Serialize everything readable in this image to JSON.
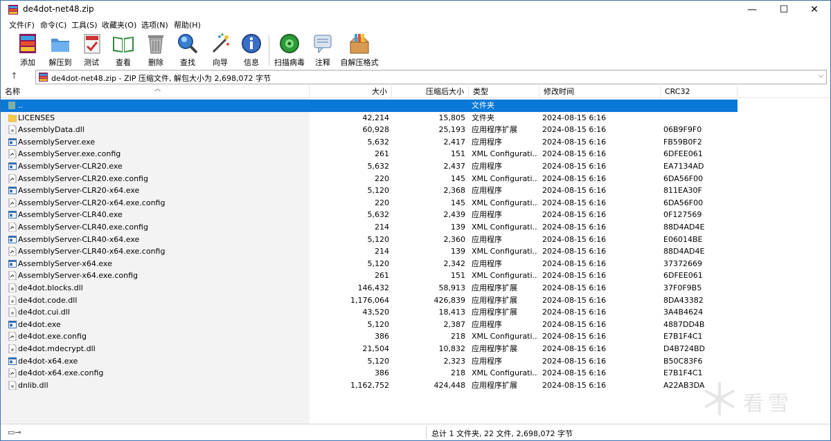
{
  "window": {
    "title": "de4dot-net48.zip",
    "controls": {
      "minimize": "—",
      "maximize": "☐",
      "close": "✕"
    }
  },
  "menu": [
    "文件(F)",
    "命令(C)",
    "工具(S)",
    "收藏夹(O)",
    "选项(N)",
    "帮助(H)"
  ],
  "toolbar": [
    {
      "label": "添加",
      "icon": "add-icon"
    },
    {
      "label": "解压到",
      "icon": "extract-icon"
    },
    {
      "label": "测试",
      "icon": "test-icon"
    },
    {
      "label": "查看",
      "icon": "view-icon"
    },
    {
      "label": "删除",
      "icon": "delete-icon"
    },
    {
      "label": "查找",
      "icon": "find-icon"
    },
    {
      "label": "向导",
      "icon": "wizard-icon"
    },
    {
      "label": "信息",
      "icon": "info-icon"
    },
    {
      "label": "扫描病毒",
      "icon": "virus-scan-icon"
    },
    {
      "label": "注释",
      "icon": "comment-icon"
    },
    {
      "label": "自解压格式",
      "icon": "sfx-icon"
    }
  ],
  "address": {
    "text": "de4dot-net48.zip - ZIP 压缩文件, 解包大小为 2,698,072 字节"
  },
  "columns": {
    "name": "名称",
    "size": "大小",
    "packed": "压缩后大小",
    "type": "类型",
    "modified": "修改时间",
    "crc": "CRC32"
  },
  "rows": [
    {
      "name": "..",
      "size": "",
      "packed": "",
      "type": "文件夹",
      "modified": "",
      "crc": "",
      "icon": "parent-folder-icon",
      "selected": true
    },
    {
      "name": "LICENSES",
      "size": "42,214",
      "packed": "15,805",
      "type": "文件夹",
      "modified": "2024-08-15 6:16",
      "crc": "",
      "icon": "folder-icon"
    },
    {
      "name": "AssemblyData.dll",
      "size": "60,928",
      "packed": "25,193",
      "type": "应用程序扩展",
      "modified": "2024-08-15 6:16",
      "crc": "06B9F9F0",
      "icon": "dll-icon"
    },
    {
      "name": "AssemblyServer.exe",
      "size": "5,632",
      "packed": "2,417",
      "type": "应用程序",
      "modified": "2024-08-15 6:16",
      "crc": "FB59B0F2",
      "icon": "exe-icon"
    },
    {
      "name": "AssemblyServer.exe.config",
      "size": "261",
      "packed": "151",
      "type": "XML Configurati...",
      "modified": "2024-08-15 6:16",
      "crc": "6DFEE061",
      "icon": "config-icon"
    },
    {
      "name": "AssemblyServer-CLR20.exe",
      "size": "5,632",
      "packed": "2,437",
      "type": "应用程序",
      "modified": "2024-08-15 6:16",
      "crc": "EA7134AD",
      "icon": "exe-icon"
    },
    {
      "name": "AssemblyServer-CLR20.exe.config",
      "size": "220",
      "packed": "145",
      "type": "XML Configurati...",
      "modified": "2024-08-15 6:16",
      "crc": "6DA56F00",
      "icon": "config-icon"
    },
    {
      "name": "AssemblyServer-CLR20-x64.exe",
      "size": "5,120",
      "packed": "2,368",
      "type": "应用程序",
      "modified": "2024-08-15 6:16",
      "crc": "811EA30F",
      "icon": "exe-icon"
    },
    {
      "name": "AssemblyServer-CLR20-x64.exe.config",
      "size": "220",
      "packed": "145",
      "type": "XML Configurati...",
      "modified": "2024-08-15 6:16",
      "crc": "6DA56F00",
      "icon": "config-icon"
    },
    {
      "name": "AssemblyServer-CLR40.exe",
      "size": "5,632",
      "packed": "2,439",
      "type": "应用程序",
      "modified": "2024-08-15 6:16",
      "crc": "0F127569",
      "icon": "exe-icon"
    },
    {
      "name": "AssemblyServer-CLR40.exe.config",
      "size": "214",
      "packed": "139",
      "type": "XML Configurati...",
      "modified": "2024-08-15 6:16",
      "crc": "88D4AD4E",
      "icon": "config-icon"
    },
    {
      "name": "AssemblyServer-CLR40-x64.exe",
      "size": "5,120",
      "packed": "2,360",
      "type": "应用程序",
      "modified": "2024-08-15 6:16",
      "crc": "E06014BE",
      "icon": "exe-icon"
    },
    {
      "name": "AssemblyServer-CLR40-x64.exe.config",
      "size": "214",
      "packed": "139",
      "type": "XML Configurati...",
      "modified": "2024-08-15 6:16",
      "crc": "88D4AD4E",
      "icon": "config-icon"
    },
    {
      "name": "AssemblyServer-x64.exe",
      "size": "5,120",
      "packed": "2,342",
      "type": "应用程序",
      "modified": "2024-08-15 6:16",
      "crc": "37372669",
      "icon": "exe-icon"
    },
    {
      "name": "AssemblyServer-x64.exe.config",
      "size": "261",
      "packed": "151",
      "type": "XML Configurati...",
      "modified": "2024-08-15 6:16",
      "crc": "6DFEE061",
      "icon": "config-icon"
    },
    {
      "name": "de4dot.blocks.dll",
      "size": "146,432",
      "packed": "58,913",
      "type": "应用程序扩展",
      "modified": "2024-08-15 6:16",
      "crc": "37F0F9B5",
      "icon": "dll-icon"
    },
    {
      "name": "de4dot.code.dll",
      "size": "1,176,064",
      "packed": "426,839",
      "type": "应用程序扩展",
      "modified": "2024-08-15 6:16",
      "crc": "8DA43382",
      "icon": "dll-icon"
    },
    {
      "name": "de4dot.cui.dll",
      "size": "43,520",
      "packed": "18,413",
      "type": "应用程序扩展",
      "modified": "2024-08-15 6:16",
      "crc": "3A4B4624",
      "icon": "dll-icon"
    },
    {
      "name": "de4dot.exe",
      "size": "5,120",
      "packed": "2,387",
      "type": "应用程序",
      "modified": "2024-08-15 6:16",
      "crc": "4887DD4B",
      "icon": "exe-icon"
    },
    {
      "name": "de4dot.exe.config",
      "size": "386",
      "packed": "218",
      "type": "XML Configurati...",
      "modified": "2024-08-15 6:16",
      "crc": "E7B1F4C1",
      "icon": "config-icon"
    },
    {
      "name": "de4dot.mdecrypt.dll",
      "size": "21,504",
      "packed": "10,832",
      "type": "应用程序扩展",
      "modified": "2024-08-15 6:16",
      "crc": "D4B724BD",
      "icon": "dll-icon"
    },
    {
      "name": "de4dot-x64.exe",
      "size": "5,120",
      "packed": "2,323",
      "type": "应用程序",
      "modified": "2024-08-15 6:16",
      "crc": "B50C83F6",
      "icon": "exe-icon"
    },
    {
      "name": "de4dot-x64.exe.config",
      "size": "386",
      "packed": "218",
      "type": "XML Configurati...",
      "modified": "2024-08-15 6:16",
      "crc": "E7B1F4C1",
      "icon": "config-icon"
    },
    {
      "name": "dnlib.dll",
      "size": "1,162,752",
      "packed": "424,448",
      "type": "应用程序扩展",
      "modified": "2024-08-15 6:16",
      "crc": "A22AB3DA",
      "icon": "dll-icon"
    }
  ],
  "status": {
    "text": "总计 1 文件夹, 22 文件, 2,698,072 字节"
  },
  "watermark": {
    "text": "看雪"
  }
}
